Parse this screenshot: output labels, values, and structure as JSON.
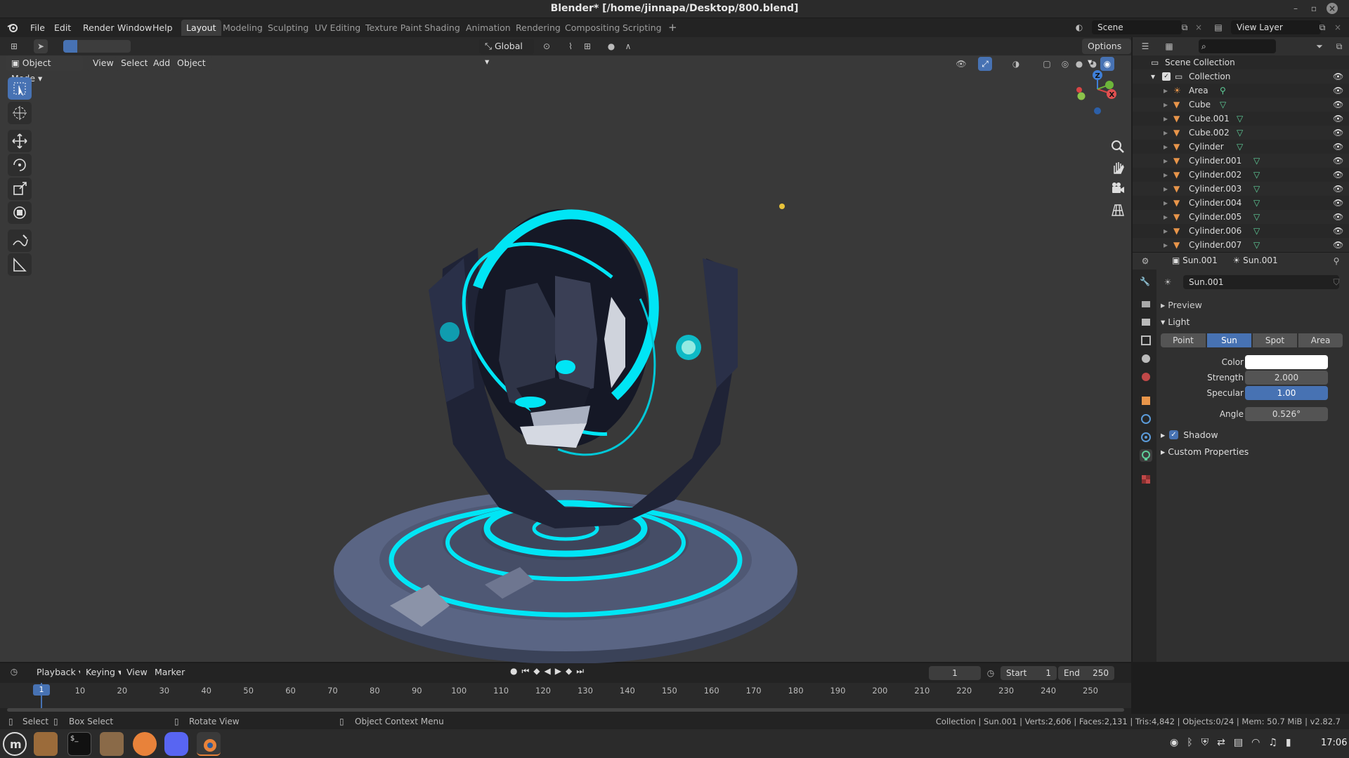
{
  "window": {
    "title": "Blender* [/home/jinnapa/Desktop/800.blend]"
  },
  "menu": [
    "File",
    "Edit",
    "Render",
    "Window",
    "Help"
  ],
  "workspaces": [
    "Layout",
    "Modeling",
    "Sculpting",
    "UV Editing",
    "Texture Paint",
    "Shading",
    "Animation",
    "Rendering",
    "Compositing",
    "Scripting"
  ],
  "active_workspace": "Layout",
  "scene": {
    "name": "Scene",
    "view_layer": "View Layer"
  },
  "viewport_header": {
    "transform_orientation": "Global",
    "options_label": "Options",
    "mode": "Object Mode",
    "menus": [
      "View",
      "Select",
      "Add",
      "Object"
    ]
  },
  "outliner": {
    "scene_collection": "Scene Collection",
    "collection": "Collection",
    "items": [
      "Area",
      "Cube",
      "Cube.001",
      "Cube.002",
      "Cylinder",
      "Cylinder.001",
      "Cylinder.002",
      "Cylinder.003",
      "Cylinder.004",
      "Cylinder.005",
      "Cylinder.006",
      "Cylinder.007"
    ]
  },
  "properties": {
    "breadcrumb_object": "Sun.001",
    "breadcrumb_data": "Sun.001",
    "datablock": "Sun.001",
    "sections": {
      "preview": "Preview",
      "light": "Light",
      "shadow": "Shadow",
      "custom": "Custom Properties"
    },
    "light_types": [
      "Point",
      "Sun",
      "Spot",
      "Area"
    ],
    "active_light_type": "Sun",
    "color_label": "Color",
    "color_value": "#ffffff",
    "strength_label": "Strength",
    "strength": "2.000",
    "specular_label": "Specular",
    "specular": "1.00",
    "angle_label": "Angle",
    "angle": "0.526°",
    "shadow_enabled": true
  },
  "timeline": {
    "menus": [
      "Playback",
      "Keying",
      "View",
      "Marker"
    ],
    "current_frame": "1",
    "start_label": "Start",
    "start": "1",
    "end_label": "End",
    "end": "250",
    "ruler": [
      "10",
      "20",
      "30",
      "40",
      "50",
      "60",
      "70",
      "80",
      "90",
      "100",
      "110",
      "120",
      "130",
      "140",
      "150",
      "160",
      "170",
      "180",
      "190",
      "200",
      "210",
      "220",
      "230",
      "240",
      "250"
    ],
    "playhead_label": "1"
  },
  "statusbar": {
    "select": "Select",
    "box_select": "Box Select",
    "rotate_view": "Rotate View",
    "context_menu": "Object Context Menu",
    "stats": "Collection | Sun.001 | Verts:2,606 | Faces:2,131 | Tris:4,842 | Objects:0/24 | Mem: 50.7 MiB | v2.82.7"
  },
  "taskbar": {
    "clock": "17:06"
  },
  "colors": {
    "accent": "#4772b3",
    "glow": "#00e5f5",
    "object_orange": "#e8954a",
    "mesh_green": "#5fcf9a"
  }
}
